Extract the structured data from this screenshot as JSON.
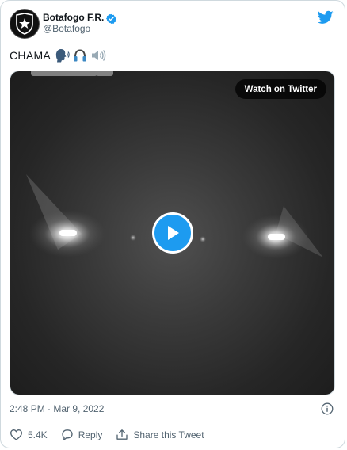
{
  "author": {
    "display_name": "Botafogo F.R.",
    "handle": "@Botafogo",
    "verified_icon": "verified-badge-icon",
    "avatar_icon": "botafogo-crest-icon"
  },
  "brand": {
    "logo_icon": "twitter-bird-icon",
    "accent_color": "#1d9bf0"
  },
  "tweet": {
    "text": "CHAMA",
    "emojis": [
      "speaking-head-icon",
      "headphone-icon",
      "speaker-high-volume-icon"
    ]
  },
  "media": {
    "watch_label": "Watch on Twitter",
    "play_icon": "play-icon"
  },
  "meta": {
    "timestamp": "2:48 PM · Mar 9, 2022",
    "info_icon": "info-icon"
  },
  "actions": {
    "like_count": "5.4K",
    "reply_label": "Reply",
    "share_label": "Share this Tweet"
  }
}
